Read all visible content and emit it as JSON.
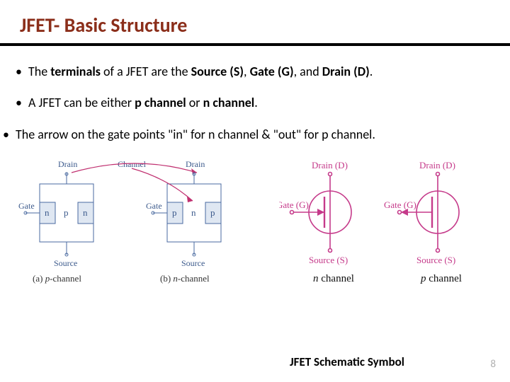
{
  "title": "JFET- Basic Structure",
  "bullets": [
    {
      "pre": "The ",
      "b1": "terminals",
      "mid1": " of a JFET are the ",
      "b2": "Source (S)",
      "mid2": ", ",
      "b3": "Gate (G)",
      "mid3": ", and ",
      "b4": "Drain (D)",
      "tail": "."
    },
    {
      "pre": "A JFET can be either ",
      "b1": "p channel",
      "mid1": " or ",
      "b2": "n channel",
      "tail": "."
    },
    {
      "pre": "The arrow on the gate points \"in\" for n channel & \"out\" for p channel."
    }
  ],
  "structure": {
    "top_label_left": "Drain",
    "top_label_channel": "Channel",
    "top_label_right": "Drain",
    "gate_label": "Gate",
    "source_label": "Source",
    "p_a": {
      "regions": [
        "n",
        "p",
        "n"
      ],
      "caption_prefix": "(a)",
      "caption_ital": "p",
      "caption_suffix": "-channel"
    },
    "p_b": {
      "regions": [
        "p",
        "n",
        "p"
      ],
      "caption_prefix": "(b)",
      "caption_ital": "n",
      "caption_suffix": "-channel"
    }
  },
  "schematic": {
    "drain": "Drain (D)",
    "gate": "Gate (G)",
    "source": "Source (S)",
    "n_label_ital": "n",
    "p_label_ital": "p",
    "label_suffix": " channel"
  },
  "caption": "JFET Schematic  Symbol",
  "page": "8",
  "colors": {
    "title": "#8b2e1a",
    "fig_stroke": "#4a6aa0",
    "fig_fill": "#dfe7f2",
    "fig_text": "#3c5a8c",
    "arrow": "#c03070",
    "sym": "#c53a8a"
  }
}
